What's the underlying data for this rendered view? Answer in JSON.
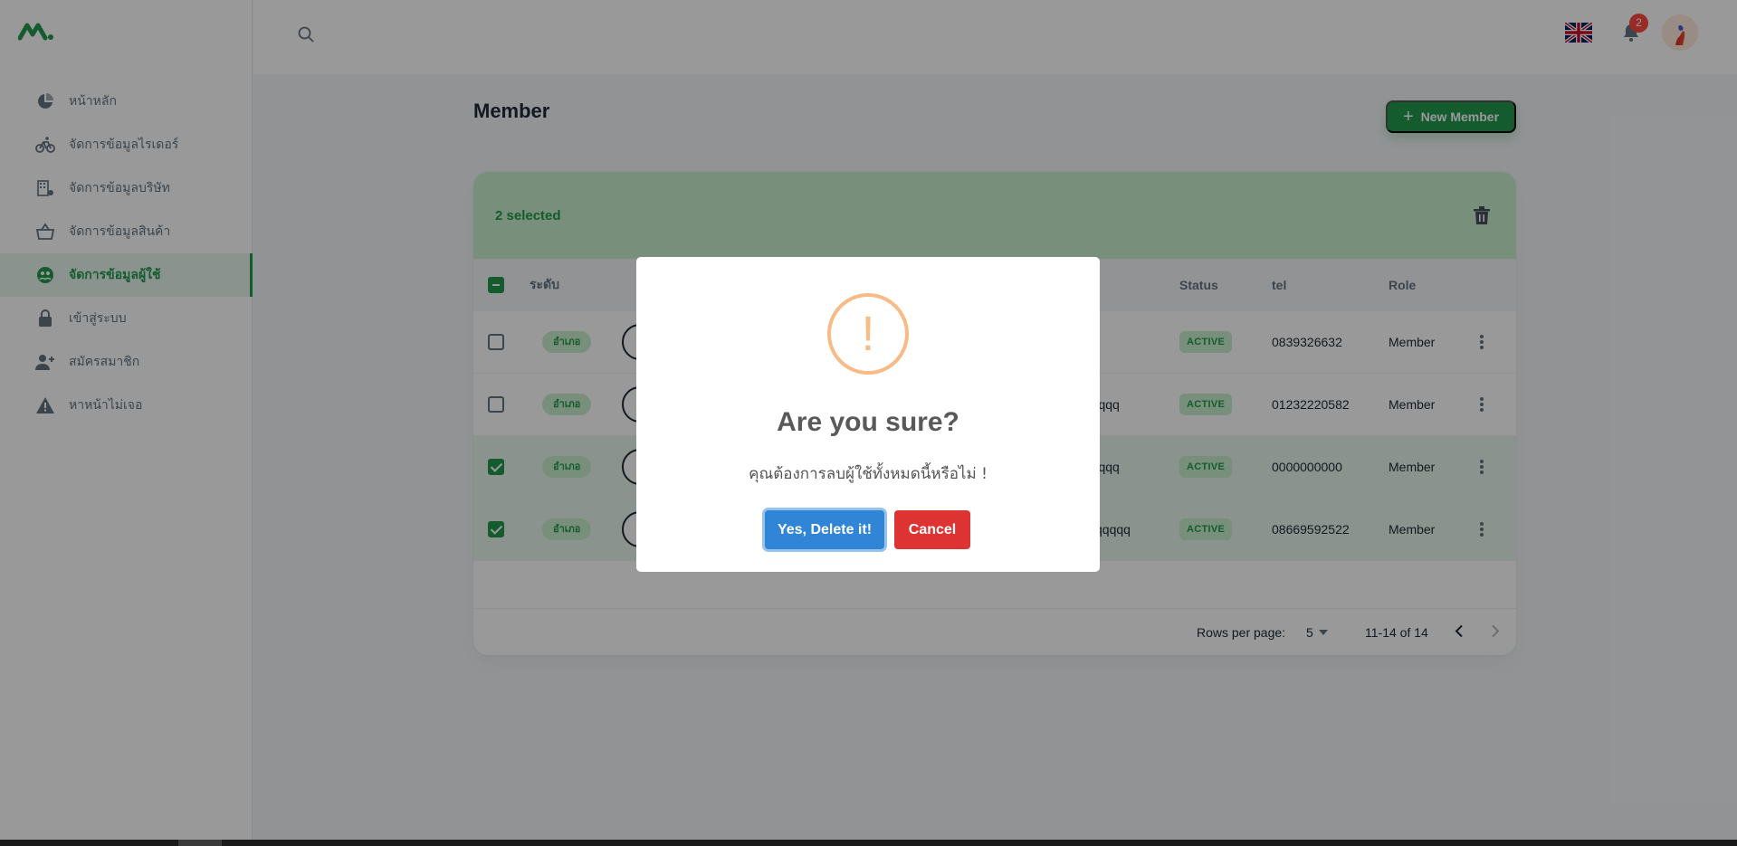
{
  "sidebar": {
    "items": [
      {
        "label": "หน้าหลัก",
        "icon": "pie-chart-icon",
        "active": false
      },
      {
        "label": "จัดการข้อมูลไรเดอร์",
        "icon": "bike-icon",
        "active": false
      },
      {
        "label": "จัดการข้อมูลบริษัท",
        "icon": "building-icon",
        "active": false
      },
      {
        "label": "จัดการข้อมูลสินค้า",
        "icon": "basket-icon",
        "active": false
      },
      {
        "label": "จัดการข้อมูลผู้ใช้",
        "icon": "user-group-icon",
        "active": true
      },
      {
        "label": "เข้าสู่ระบบ",
        "icon": "lock-icon",
        "active": false
      },
      {
        "label": "สมัครสมาชิก",
        "icon": "person-add-icon",
        "active": false
      },
      {
        "label": "หาหน้าไม่เจอ",
        "icon": "warning-icon",
        "active": false
      }
    ]
  },
  "header": {
    "notification_count": "2"
  },
  "main": {
    "title": "Member",
    "new_button_label": "New Member",
    "selected_text": "2 selected",
    "columns": {
      "level": "ระดับ",
      "status": "Status",
      "tel": "tel",
      "role": "Role"
    },
    "rows": [
      {
        "checked": false,
        "level": "อำเภอ",
        "name_tail": "",
        "status": "ACTIVE",
        "tel": "0839326632",
        "role": "Member"
      },
      {
        "checked": false,
        "level": "อำเภอ",
        "name_tail": "k qqqqq",
        "status": "ACTIVE",
        "tel": "01232220582",
        "role": "Member"
      },
      {
        "checked": true,
        "level": "อำเภอ",
        "name_tail": "k qqqqq",
        "status": "ACTIVE",
        "tel": "0000000000",
        "role": "Member"
      },
      {
        "checked": true,
        "level": "อำเภอ",
        "name_tail": "qqqqq",
        "status": "ACTIVE",
        "tel": "08669592522",
        "role": "Member"
      }
    ],
    "pagination": {
      "rows_label": "Rows per page:",
      "rows_value": "5",
      "range": "11-14 of 14"
    }
  },
  "dialog": {
    "icon": "!",
    "title": "Are you sure?",
    "text": "คุณต้องการลบผู้ใช้ทั้งหมดนี้หรือไม่ !",
    "confirm_label": "Yes, Delete it!",
    "cancel_label": "Cancel"
  },
  "colors": {
    "primary": "#229a4d",
    "confirm": "#3085d6",
    "cancel": "#dd3333",
    "warning": "#f8bb86"
  }
}
